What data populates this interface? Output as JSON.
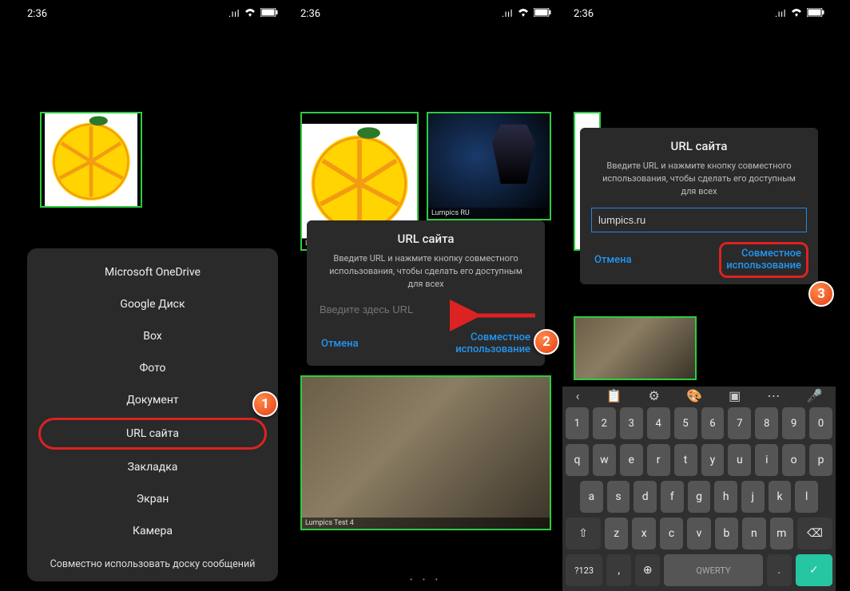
{
  "status": {
    "time": "2:36",
    "net": ".ııl",
    "wifi": "⊚",
    "batt": "▭"
  },
  "menu": {
    "items": [
      "Microsoft OneDrive",
      "Google Диск",
      "Box",
      "Фото",
      "Документ",
      "URL сайта",
      "Закладка",
      "Экран",
      "Камера"
    ],
    "footer": "Совместно использовать доску сообщений"
  },
  "dialog": {
    "title": "URL сайта",
    "text1": "Введите URL и нажмите кнопку совместного",
    "text2": "использования, чтобы сделать его доступным",
    "text3": "для всех",
    "placeholder": "Введите здесь URL",
    "value": "lumpics.ru",
    "cancel": "Отмена",
    "share1": "Совместное",
    "share2": "использование"
  },
  "thumbs": {
    "cap1": "Lumpics RU",
    "cap2": "Lumpics Test 2",
    "cap3": "Lumpics Test 4"
  },
  "keyboard": {
    "row_num": [
      "1",
      "2",
      "3",
      "4",
      "5",
      "6",
      "7",
      "8",
      "9",
      "0"
    ],
    "row1": [
      "q",
      "w",
      "e",
      "r",
      "t",
      "y",
      "u",
      "i",
      "o",
      "p"
    ],
    "row2": [
      "a",
      "s",
      "d",
      "f",
      "g",
      "h",
      "j",
      "k",
      "l"
    ],
    "row3_shift": "⇧",
    "row3": [
      "z",
      "x",
      "c",
      "v",
      "b",
      "n",
      "m"
    ],
    "row3_del": "⌫",
    "row4": {
      "sym": "?123",
      "comma": ",",
      "globe": "⊕",
      "space": "QWERTY",
      "dot": ".",
      "enter": "✓"
    }
  },
  "badges": {
    "b1": "1",
    "b2": "2",
    "b3": "3"
  }
}
